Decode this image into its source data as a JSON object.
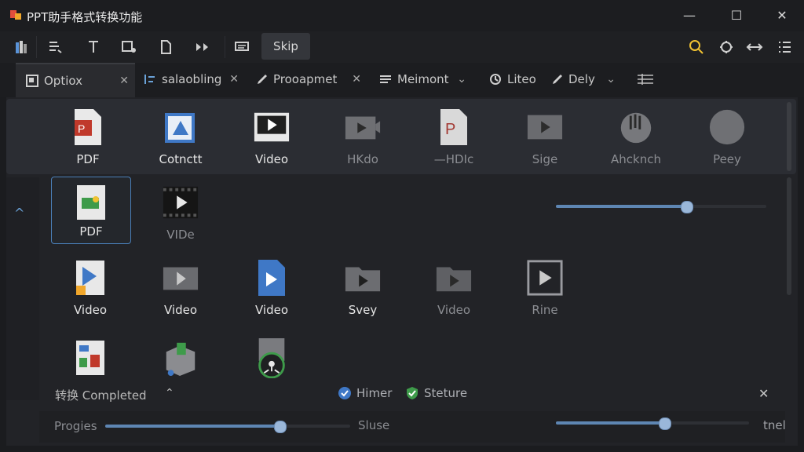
{
  "window": {
    "title": "PPT助手格式转换功能",
    "minimize": "—",
    "maximize": "☐",
    "close": "✕"
  },
  "toolbar": {
    "skip_label": "Skip"
  },
  "tabs": [
    {
      "label": "Optiox"
    },
    {
      "label": "salaobling"
    },
    {
      "label": "Prooapmet"
    },
    {
      "label": "Meimont"
    },
    {
      "label": "Liteo"
    },
    {
      "label": "Dely"
    }
  ],
  "top_formats": [
    "PDF",
    "Cotnctt",
    "Video",
    "HKdo",
    "—HDIc",
    "Sige",
    "Ahcknch",
    "Peey"
  ],
  "grid_row1": [
    "PDF",
    "VIDe"
  ],
  "grid_row2": [
    "Video",
    "Video",
    "Video",
    "Svey",
    "Video",
    "Rine"
  ],
  "sliders": {
    "top_right_value": 0.62,
    "progress_value": 0.71,
    "bottom_right_value": 0.56
  },
  "status": {
    "text": "转换 Completed",
    "check1": "Himer",
    "check2": "Steture"
  },
  "bottom": {
    "progress_label": "Progies",
    "slide_label": "Sluse",
    "right_label": "tnel"
  },
  "colors": {
    "accent": "#5e86b3",
    "pdf_red": "#c0392b",
    "blue_icon": "#3f78c6",
    "green_icon": "#3e9b4a"
  }
}
